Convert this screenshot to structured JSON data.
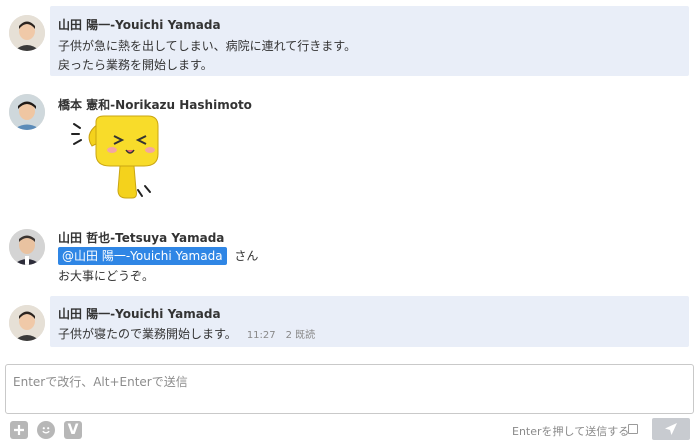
{
  "messages": [
    {
      "sender": "山田 陽一-Youichi Yamada",
      "lines": [
        "子供が急に熱を出してしまい、病院に連れて行きます。",
        "戻ったら業務を開始します。"
      ]
    },
    {
      "sender": "橋本 憲和-Norikazu Hashimoto"
    },
    {
      "sender": "山田 哲也-Tetsuya Yamada",
      "mention": "@山田 陽一-Youichi Yamada",
      "mention_suffix": "さん",
      "line2": "お大事にどうぞ。"
    },
    {
      "sender": "山田 陽一-Youichi Yamada",
      "text": "子供が寝たので業務開始します。",
      "time": "11:27",
      "read": "2 既読"
    }
  ],
  "composer": {
    "placeholder": "Enterで改行、Alt+Enterで送信",
    "send_on_enter_label": "Enterを押して送信する",
    "send_on_enter_checked": false
  },
  "toolbar": {
    "add_icon": "plus-icon",
    "emoji_icon": "smiley-icon",
    "v_icon_label": "V",
    "send_icon": "paper-plane-icon"
  },
  "colors": {
    "highlight_bg": "#e9eef8",
    "mention_bg": "#2f86e5",
    "send_button_bg": "#c8cbd0"
  }
}
